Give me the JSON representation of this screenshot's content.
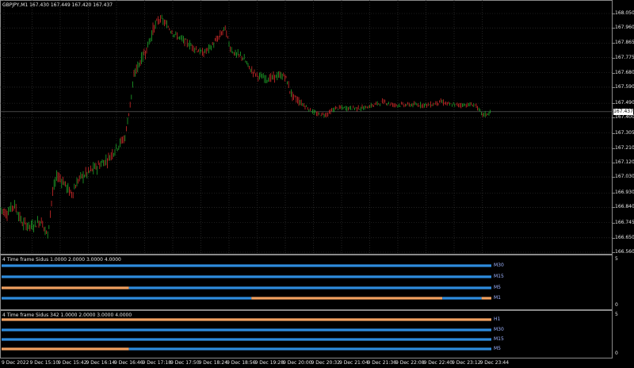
{
  "main_header": "GBPJPY,M1  167.430 167.449 167.420 167.437",
  "current_price": "167.437",
  "price_ticks": [
    "168.050",
    "167.960",
    "167.865",
    "167.775",
    "167.680",
    "167.590",
    "167.490",
    "167.400",
    "167.305",
    "167.210",
    "167.120",
    "167.030",
    "166.930",
    "166.840",
    "166.745",
    "166.650",
    "166.560"
  ],
  "time_labels": [
    "9 Dec 2022",
    "9 Dec 15:10",
    "9 Dec 15:42",
    "9 Dec 16:14",
    "9 Dec 16:46",
    "9 Dec 17:18",
    "9 Dec 17:50",
    "9 Dec 18:24",
    "9 Dec 18:56",
    "9 Dec 19:28",
    "9 Dec 20:00",
    "9 Dec 20:32",
    "9 Dec 21:04",
    "9 Dec 21:36",
    "9 Dec 22:08",
    "9 Dec 22:40",
    "9 Dec 23:12",
    "9 Dec 23:44"
  ],
  "indicator1": {
    "header": "4 Time frame Sidus 1.0000 2.0000 3.0000 4.0000",
    "axis_top": "5",
    "axis_bottom": "0",
    "rows": [
      {
        "label": "M30",
        "segments": [
          {
            "from": 0,
            "to": 1,
            "color": "#2e8bdc"
          }
        ]
      },
      {
        "label": "M15",
        "segments": [
          {
            "from": 0,
            "to": 1,
            "color": "#2e8bdc"
          }
        ]
      },
      {
        "label": "M5",
        "segments": [
          {
            "from": 0,
            "to": 0.26,
            "color": "#f0a060"
          },
          {
            "from": 0.26,
            "to": 1,
            "color": "#2e8bdc"
          }
        ]
      },
      {
        "label": "M1",
        "segments": [
          {
            "from": 0,
            "to": 0.51,
            "color": "#2e8bdc"
          },
          {
            "from": 0.51,
            "to": 0.9,
            "color": "#f0a060"
          },
          {
            "from": 0.9,
            "to": 0.98,
            "color": "#2e8bdc"
          },
          {
            "from": 0.98,
            "to": 1,
            "color": "#f0a060"
          }
        ]
      }
    ]
  },
  "indicator2": {
    "header": "4 Time frame Sidus 342 1.0000 2.0000 3.0000 4.0000",
    "axis_top": "5",
    "axis_bottom": "0",
    "rows": [
      {
        "label": "H1",
        "segments": [
          {
            "from": 0,
            "to": 1,
            "color": "#f0a060"
          }
        ]
      },
      {
        "label": "M30",
        "segments": [
          {
            "from": 0,
            "to": 1,
            "color": "#2e8bdc"
          }
        ]
      },
      {
        "label": "M15",
        "segments": [
          {
            "from": 0,
            "to": 1,
            "color": "#2e8bdc"
          }
        ]
      },
      {
        "label": "M5",
        "segments": [
          {
            "from": 0,
            "to": 0.26,
            "color": "#f0a060"
          },
          {
            "from": 0.26,
            "to": 1,
            "color": "#2e8bdc"
          }
        ]
      }
    ]
  },
  "colors": {
    "bull": "#1fa52a",
    "bear": "#d22a2a",
    "grid": "#3a3a3a",
    "frame": "#8a8a8a"
  }
}
